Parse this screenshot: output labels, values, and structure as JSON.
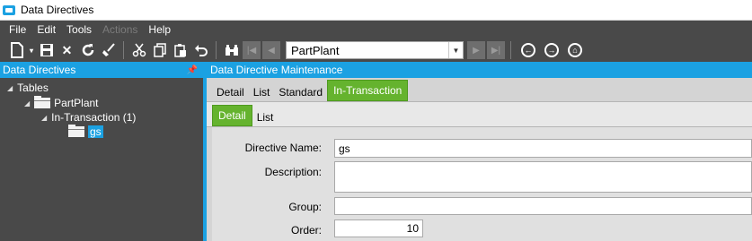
{
  "window": {
    "title": "Data Directives"
  },
  "menu": [
    {
      "label": "File",
      "enabled": true
    },
    {
      "label": "Edit",
      "enabled": true
    },
    {
      "label": "Tools",
      "enabled": true
    },
    {
      "label": "Actions",
      "enabled": false
    },
    {
      "label": "Help",
      "enabled": true
    }
  ],
  "toolbar": {
    "icons": [
      "new-icon",
      "save-icon",
      "delete-icon",
      "refresh-icon",
      "clear-icon",
      "cut-icon",
      "copy-icon",
      "paste-icon",
      "undo-icon",
      "search-binoculars-icon"
    ],
    "combo_value": "PartPlant",
    "nav_icons": [
      "first-record-icon",
      "previous-record-icon",
      "next-record-icon",
      "last-record-icon"
    ],
    "circle_icons": [
      "back-icon",
      "forward-icon",
      "home-icon"
    ]
  },
  "left_panel": {
    "title": "Data Directives",
    "tree": {
      "root": "Tables",
      "table": "PartPlant",
      "group": "In-Transaction (1)",
      "item": "gs"
    }
  },
  "right_panel": {
    "title": "Data Directive Maintenance",
    "tabs": [
      "Detail",
      "List",
      "Standard",
      "In-Transaction"
    ],
    "active_tab": "In-Transaction",
    "subtabs": [
      "Detail",
      "List"
    ],
    "active_subtab": "Detail",
    "form": {
      "directive_name_label": "Directive Name:",
      "directive_name_value": "gs",
      "description_label": "Description:",
      "description_value": "",
      "group_label": "Group:",
      "group_value": "",
      "order_label": "Order:",
      "order_value": "10"
    }
  },
  "colors": {
    "accent": "#1ba1e2",
    "chrome_dark": "#494949",
    "tab_active": "#65b32e"
  }
}
